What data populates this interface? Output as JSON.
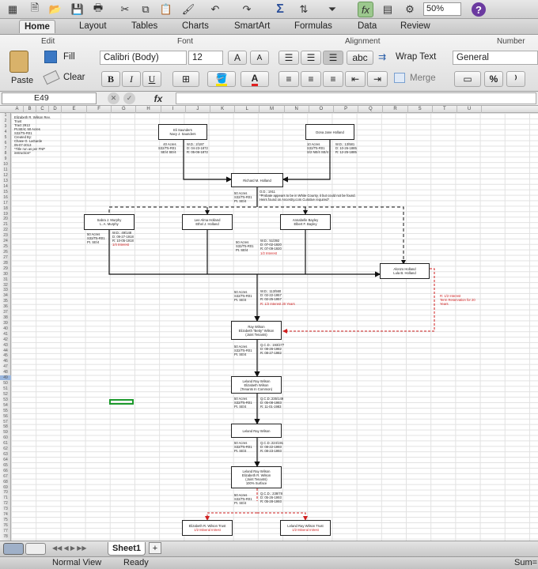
{
  "toolbar": {
    "zoom": "50%",
    "icons": [
      "grid-icon",
      "new-icon",
      "open-icon",
      "save-icon",
      "print-icon",
      "cut-icon",
      "copy-icon",
      "paste-icon",
      "format-painter-icon",
      "undo-icon",
      "redo-icon",
      "autosum-icon",
      "sort-icon",
      "filter-icon",
      "function-icon",
      "gallery-icon",
      "toolbox-icon",
      "help-icon"
    ]
  },
  "tabs": [
    "Home",
    "Layout",
    "Tables",
    "Charts",
    "SmartArt",
    "Formulas",
    "Data",
    "Review"
  ],
  "ribbon": {
    "edit_label": "Edit",
    "font_label": "Font",
    "alignment_label": "Alignment",
    "number_label": "Number",
    "paste": "Paste",
    "fill": "Fill",
    "clear": "Clear",
    "font_name": "Calibri (Body)",
    "font_size": "12",
    "grow": "A",
    "shrink": "A",
    "bold": "B",
    "italic": "I",
    "underline": "U",
    "font_color": "A",
    "abc": "abc",
    "wrap_text": "Wrap Text",
    "merge": "Merge",
    "number_format": "General",
    "percent": "%",
    "comma": "⁾"
  },
  "formula_bar": {
    "cell": "E49",
    "fx": "fx",
    "value": ""
  },
  "columns": [
    "A",
    "B",
    "C",
    "D",
    "E",
    "F",
    "G",
    "H",
    "I",
    "J",
    "K",
    "L",
    "M",
    "N",
    "O",
    "P",
    "Q",
    "R",
    "S",
    "T",
    "U"
  ],
  "rows": [
    "1",
    "2",
    "3",
    "4",
    "5",
    "6",
    "7",
    "8",
    "9",
    "10",
    "11",
    "12",
    "13",
    "14",
    "15",
    "16",
    "17",
    "18",
    "19",
    "20",
    "21",
    "22",
    "23",
    "24",
    "25",
    "26",
    "27",
    "28",
    "29",
    "30",
    "31",
    "32",
    "33",
    "34",
    "35",
    "36",
    "37",
    "38",
    "39",
    "40",
    "41",
    "42",
    "43",
    "44",
    "45",
    "46",
    "47",
    "48",
    "49",
    "50",
    "51",
    "52",
    "53",
    "54",
    "55",
    "56",
    "57",
    "58",
    "59",
    "60",
    "61",
    "62",
    "63",
    "64",
    "65",
    "66",
    "67",
    "68",
    "69",
    "70",
    "71",
    "72",
    "73",
    "74",
    "75",
    "76",
    "77",
    "78"
  ],
  "notes": {
    "header": "Elizabeth R. Wilson Rev.\nTrust\nTract 2913\nPt.SE/4; 50 Acres\nS32/T5-R01\nCreated By:\nChase G. LaGarde\n05-07-2013\n*Title run as per FNP\ninstruction*",
    "saunders_info": "40 Acres\nS32/T5-R01\nSE/4 SE/4",
    "saunders_deed": "W.D.: 2/187\nD: 04-23-1872\nR: 05-06-1872",
    "holland_info": "10 Acres\nS32/T5-R01\nS/2 NE/4 SE/4",
    "holland_deed": "W.D.: 13/581\nD: 10-26-1885\nR: 12-25-1885",
    "od_info": "50 Acres\nS32/T5-R01\nPt. SE/4",
    "od_note": "O.D.: 1911\n*Probate appears to be in White County, it but could not be found.\nHeirs found on Ancestry.com Curative required*",
    "murphy_info": "50 Acres\nS32/T5-R01\nPt. SE/4",
    "murphy_deed": "W.D.: 49/148\nD: 09-27-1918\nR: 10-05-1918",
    "murphy_interest": "1/4 Interest",
    "bayley_info": "50 Acres\nS32/T5-R01\nPt. SE/4",
    "bayley_deed": "W.D.: 51/392\nD: 07-02-1920\nR: 07-09-1920",
    "bayley_interest": "1/2 Interest",
    "alonzo_info": "50 Acres\nS32/T5-R01\nPt. SE/4",
    "alonzo_deed": "W.D.: 113/560\nD: 02-22-1957\nR: 02-25-1957",
    "alonzo_interest": "R: 1/2 Interest 20 Years",
    "term_note": "R: 1/2 Interest\nTerm Reservation for 20\nYears",
    "ray_info": "50 Acres\nS32/T5-R01\nPt. SE/4",
    "ray_deed": "Q.C.D.: 193/277\nD: 08-26-1982\nR: 08-27-1982",
    "leland1_info": "50 Acres\nS32/T5-R01\nPt. SE/4",
    "leland1_deed": "Q.C.D.:235/149\nD: 05-08-1983\nR: 11-01-1983",
    "leland2_info": "50 Acres\nS32/T5-R01\nPt. SE/4",
    "leland2_deed": "Q.C.D.:224/191\nD: 08-22-1993\nR: 08-23-1993",
    "final_info": "50 Acres\nS32/T5-R01\nPt. SE/4",
    "final_deed": "Q.C.D.: 238/78\nD: 05-26-1993\nR: 05-28-1993"
  },
  "boxes": {
    "saunders": [
      "Eli Saunders",
      "Nacy J. Saunders"
    ],
    "dona": [
      "Dona Jane Holland"
    ],
    "richard": [
      "Richard M. Holland"
    ],
    "sabra": [
      "Sabra J. Murphy",
      "L. A. Murphy"
    ],
    "lee": [
      "Lee Alma Holland",
      "Ethel J. Holland"
    ],
    "annabelle": [
      "Annabelle Bayley",
      "Elbert F. Bayley"
    ],
    "alonzo": [
      "Alonzo Holland",
      "Lula B. Holland"
    ],
    "ray": [
      "Ray Wilson",
      "Elizabeth \"Betty\" Wilson",
      "(Joint Tenants)"
    ],
    "leland_elizabeth": [
      "Leland Ray Wilson",
      "Elizabeth Wilson",
      "(Tenants In Common)"
    ],
    "leland_only": [
      "Leland Ray Wilson"
    ],
    "leland_joint": [
      "Leland Ray Wilson",
      "Elizabeth R. Wilson",
      "(Joint Tenants)",
      "100% Surface"
    ],
    "trust": [
      "Elizabeth R. Wilson Trust",
      "1/2 Mineral Intrest"
    ],
    "leland_trust": [
      "Leland Ray Wilson Trust",
      "1/2 Mineral Intrest"
    ]
  },
  "sheet_tab": "Sheet1",
  "add_sheet": "+",
  "status": {
    "view": "Normal View",
    "state": "Ready",
    "sum": "Sum="
  },
  "colors": {
    "accent_red": "#d02020",
    "selection": "#1c9a2c"
  }
}
